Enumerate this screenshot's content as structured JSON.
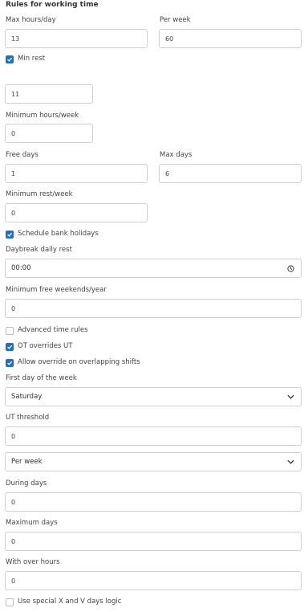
{
  "section_title": "Rules for working time",
  "max_hours_day": {
    "label": "Max hours/day",
    "value": "13"
  },
  "per_week": {
    "label": "Per week",
    "value": "60"
  },
  "min_rest": {
    "label": "Min rest",
    "checked": true,
    "value": "11"
  },
  "min_hours_week": {
    "label": "Minimum hours/week",
    "value": "0"
  },
  "free_days": {
    "label": "Free days",
    "value": "1"
  },
  "max_days": {
    "label": "Max days",
    "value": "6"
  },
  "min_rest_week": {
    "label": "Minimum rest/week",
    "value": "0"
  },
  "schedule_bank_holidays": {
    "label": "Schedule bank holidays",
    "checked": true
  },
  "daybreak_daily_rest": {
    "label": "Daybreak daily rest",
    "value": "00:00",
    "icon": "clock-icon"
  },
  "min_free_weekends": {
    "label": "Minimum free weekends/year",
    "value": "0"
  },
  "advanced_time_rules": {
    "label": "Advanced time rules",
    "checked": false
  },
  "ot_overrides_ut": {
    "label": "OT overrides UT",
    "checked": true
  },
  "allow_override": {
    "label": "Allow override on overlapping shifts",
    "checked": true
  },
  "first_day_of_week": {
    "label": "First day of the week",
    "value": "Saturday",
    "icon": "chevron-down-icon"
  },
  "ut_threshold": {
    "label": "UT threshold",
    "value": "0"
  },
  "period_select": {
    "value": "Per week",
    "icon": "chevron-down-icon"
  },
  "during_days": {
    "label": "During days",
    "value": "0"
  },
  "maximum_days": {
    "label": "Maximum days",
    "value": "0"
  },
  "with_over_hours": {
    "label": "With over hours",
    "value": "0"
  },
  "special_xv_logic": {
    "label": "Use special X and V days logic",
    "checked": false
  },
  "colors": {
    "accent": "#1f6fc4",
    "border": "#cfcfcf",
    "text": "#333333"
  }
}
